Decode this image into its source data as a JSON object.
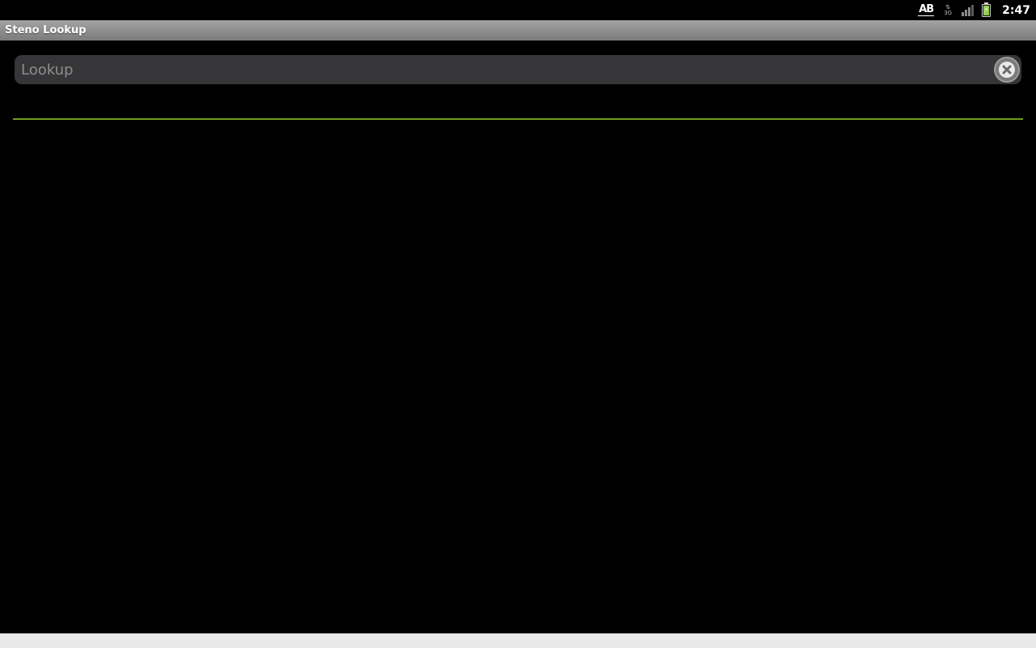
{
  "status_bar": {
    "input_method_label": "AB",
    "network_label": "3G",
    "clock": "2:47",
    "icons": {
      "input_method": "keyboard-ab-icon",
      "network": "data-3g-icon",
      "signal": "signal-strength-icon",
      "battery": "battery-charging-icon"
    },
    "battery_color": "#8fd14f"
  },
  "app": {
    "title": "Steno Lookup"
  },
  "search": {
    "placeholder": "Lookup",
    "value": "",
    "clear_icon": "clear-x-icon"
  },
  "results": {
    "items": []
  },
  "colors": {
    "background": "#000000",
    "divider": "#6f9b1a",
    "title_bar": "#8d8d8d",
    "field_background": "#363638"
  }
}
